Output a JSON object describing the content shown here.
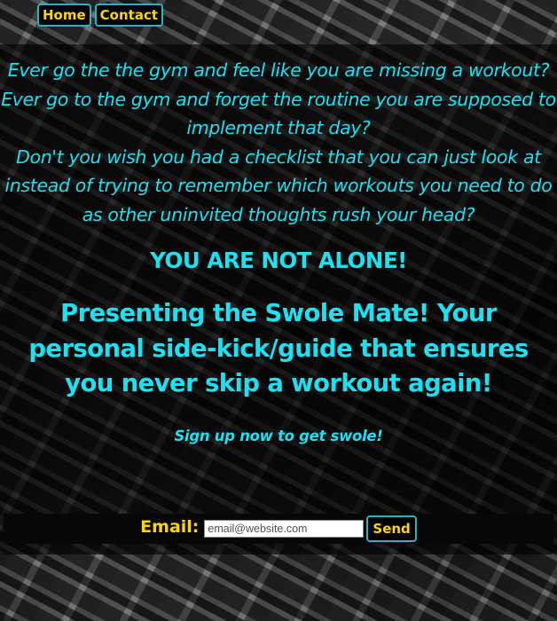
{
  "nav": {
    "home_label": "Home",
    "contact_label": "Contact"
  },
  "intro": {
    "lines": [
      "Ever go the the gym and feel like you are missing a workout?",
      "Ever go to the gym and forget the routine you are supposed to implement that day?",
      "Don't you wish you had a checklist that you can just look at instead of trying to remember which workouts you need to do as other uninvited thoughts rush your head?"
    ]
  },
  "headline": "YOU ARE NOT ALONE!",
  "presenting": "Presenting the Swole Mate! Your personal side-kick/guide that ensures you never skip a workout again!",
  "signup_text": "Sign up now to get swole!",
  "email_form": {
    "label": "Email:",
    "placeholder": "email@website.com",
    "value": "",
    "send_label": "Send"
  },
  "colors": {
    "accent_text": "#1ee0f0",
    "button_text": "#ffd500",
    "button_border": "#2ab3c0",
    "panel_bg": "rgba(0,0,0,0.62)"
  },
  "icons": {
    "background": "gym-dumbbell-rack-photo"
  }
}
